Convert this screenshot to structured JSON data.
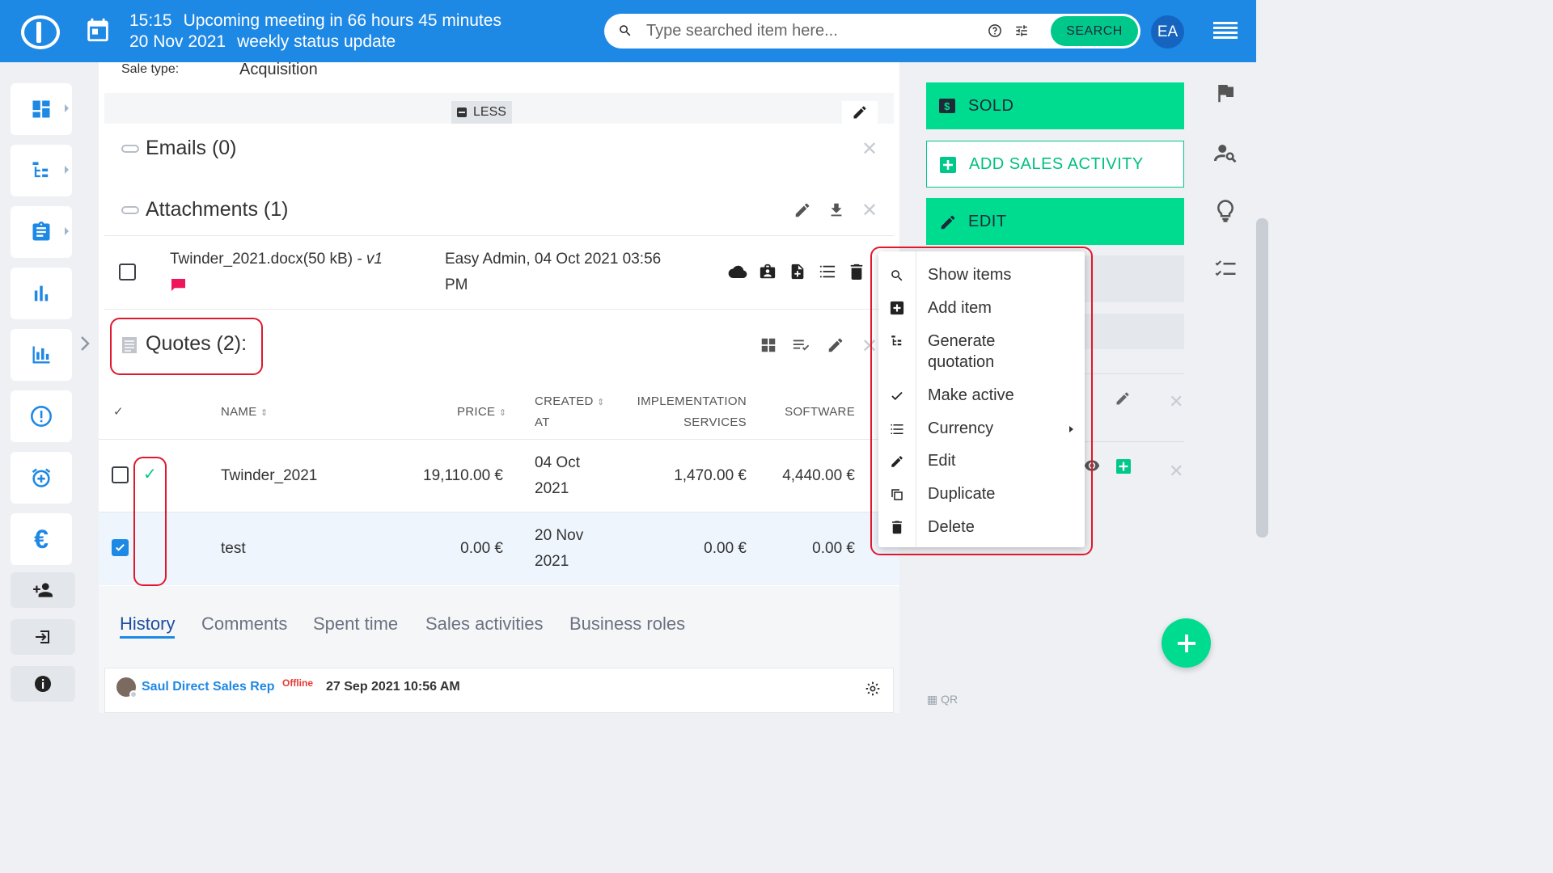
{
  "header": {
    "time": "15:15",
    "meeting_text": "Upcoming meeting in 66 hours 45 minutes",
    "date": "20 Nov 2021",
    "meeting_name": "weekly status update",
    "search_placeholder": "Type searched item here...",
    "search_button": "SEARCH",
    "avatar_initials": "EA"
  },
  "details": {
    "sale_type_label": "Sale type:",
    "sale_type_value": "Acquisition",
    "less_button": "LESS"
  },
  "emails": {
    "title": "Emails (0)"
  },
  "attachments": {
    "title": "Attachments (1)",
    "file_name": "Twinder_2021.docx(50 kB)",
    "version": "- v1",
    "uploaded_line1": "Easy Admin, 04 Oct 2021 03:56",
    "uploaded_line2": "PM"
  },
  "quotes": {
    "title": "Quotes (2):",
    "columns": {
      "check": "✓",
      "name": "NAME",
      "price": "PRICE",
      "created_1": "CREATED",
      "created_2": "AT",
      "impl_1": "IMPLEMENTATION",
      "impl_2": "SERVICES",
      "software": "SOFTWARE"
    },
    "rows": [
      {
        "name": "Twinder_2021",
        "price": "19,110.00 €",
        "created_1": "04 Oct",
        "created_2": "2021",
        "impl": "1,470.00 €",
        "software": "4,440.00 €",
        "active": true,
        "checked": false
      },
      {
        "name": "test",
        "price": "0.00 €",
        "created_1": "20 Nov",
        "created_2": "2021",
        "impl": "0.00 €",
        "software": "0.00 €",
        "active": false,
        "checked": true
      }
    ]
  },
  "tabs": [
    "History",
    "Comments",
    "Spent time",
    "Sales activities",
    "Business roles"
  ],
  "history": {
    "user": "Saul Direct Sales Rep",
    "status": "Offline",
    "timestamp": "27 Sep 2021 10:56 AM"
  },
  "actions": {
    "sold": "SOLD",
    "add_activity": "ADD SALES ACTIVITY",
    "edit": "EDIT"
  },
  "context_menu": {
    "show_items": "Show items",
    "add_item": "Add item",
    "generate_1": "Generate",
    "generate_2": "quotation",
    "make_active": "Make active",
    "currency": "Currency",
    "edit": "Edit",
    "duplicate": "Duplicate",
    "delete": "Delete"
  },
  "footer": {
    "qr": "QR"
  },
  "colors": {
    "primary": "#1e88e5",
    "accent_green": "#00dc8f",
    "highlight_red": "#e0182d",
    "offline_red": "#e53935"
  }
}
